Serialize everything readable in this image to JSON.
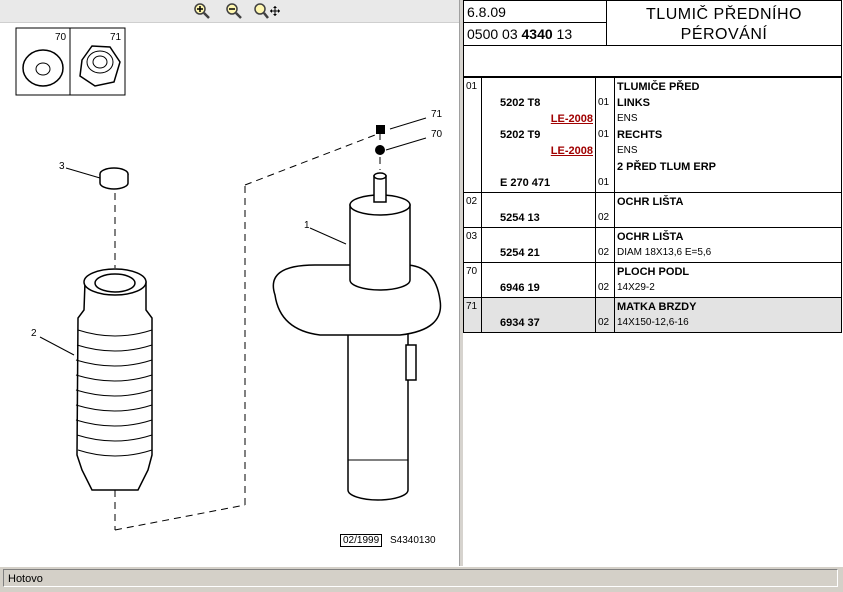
{
  "toolbar": {
    "icons": [
      "zoom-in-icon",
      "zoom-out-icon",
      "zoom-pan-icon"
    ]
  },
  "header": {
    "date": "6.8.09",
    "code_a": "0500 03",
    "code_b": "4340",
    "code_c": "13",
    "title_line1": "TLUMIČ PŘEDNÍHO",
    "title_line2": "PÉROVÁNÍ"
  },
  "diagram": {
    "callouts": [
      "70",
      "71",
      "3",
      "2",
      "1",
      "71",
      "70"
    ],
    "date_box": "02/1999",
    "ref": "S4340130"
  },
  "parts": [
    {
      "pos": "01",
      "rows": [
        {
          "ref": "",
          "note": "",
          "qty": "",
          "desc": "TLUMIČE PŘED",
          "desc_bold": true
        },
        {
          "ref": "5202 T8",
          "note": "",
          "qty": "01",
          "desc": "LINKS",
          "desc_bold": true
        },
        {
          "ref": "",
          "note": "LE-2008",
          "qty": "",
          "desc": "ENS",
          "desc_bold": false
        },
        {
          "ref": "5202 T9",
          "note": "",
          "qty": "01",
          "desc": "RECHTS",
          "desc_bold": true
        },
        {
          "ref": "",
          "note": "LE-2008",
          "qty": "",
          "desc": "ENS",
          "desc_bold": false
        },
        {
          "ref": "",
          "note": "",
          "qty": "",
          "desc": "2 PŘED TLUM ERP",
          "desc_bold": true
        },
        {
          "ref": "E 270 471",
          "note": "",
          "qty": "01",
          "desc": "",
          "desc_bold": false
        }
      ]
    },
    {
      "pos": "02",
      "rows": [
        {
          "ref": "",
          "note": "",
          "qty": "",
          "desc": "OCHR LIŠTA",
          "desc_bold": true
        },
        {
          "ref": "5254 13",
          "note": "",
          "qty": "02",
          "desc": "",
          "desc_bold": false
        }
      ]
    },
    {
      "pos": "03",
      "rows": [
        {
          "ref": "",
          "note": "",
          "qty": "",
          "desc": "OCHR LIŠTA",
          "desc_bold": true
        },
        {
          "ref": "5254 21",
          "note": "",
          "qty": "02",
          "desc": "DIAM 18X13,6 E=5,6",
          "desc_bold": false
        }
      ]
    },
    {
      "pos": "70",
      "rows": [
        {
          "ref": "",
          "note": "",
          "qty": "",
          "desc": "PLOCH PODL",
          "desc_bold": true
        },
        {
          "ref": "6946 19",
          "note": "",
          "qty": "02",
          "desc": "14X29-2",
          "desc_bold": false
        }
      ]
    },
    {
      "pos": "71",
      "selected": true,
      "rows": [
        {
          "ref": "",
          "note": "",
          "qty": "",
          "desc": "MATKA BRZDY",
          "desc_bold": true
        },
        {
          "ref": "6934 37",
          "note": "",
          "qty": "02",
          "desc": "14X150-12,6-16",
          "desc_bold": false
        }
      ]
    }
  ],
  "status": "Hotovo"
}
